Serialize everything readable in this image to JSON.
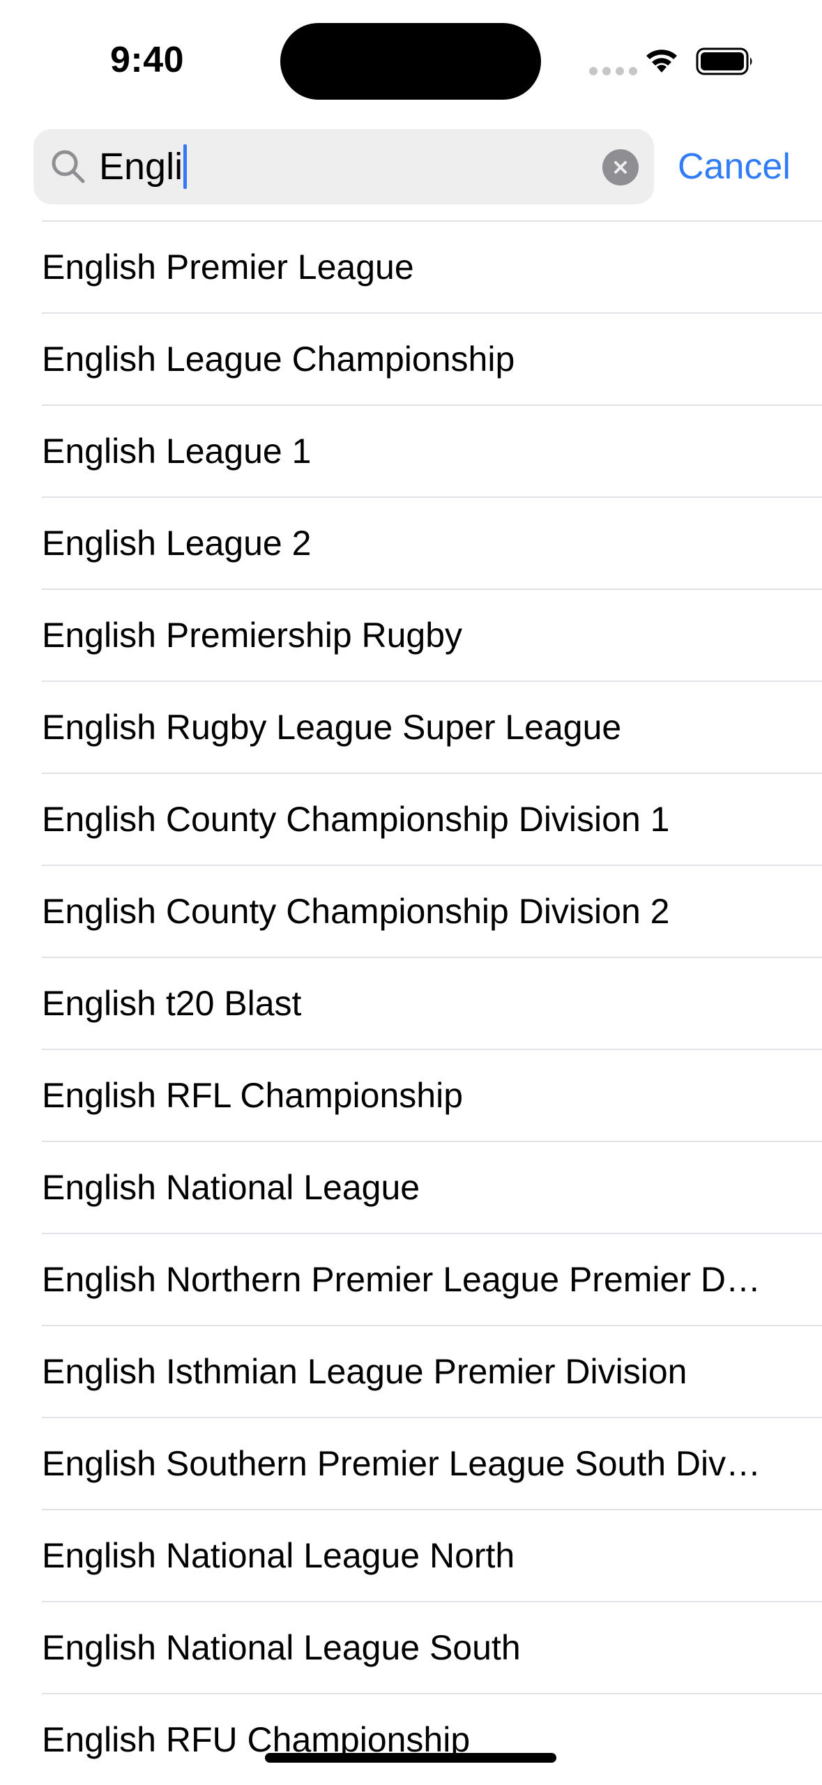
{
  "status_bar": {
    "time": "9:40"
  },
  "search": {
    "value": "Engli",
    "cancel_label": "Cancel",
    "accent_color": "#2f7cf6"
  },
  "results": [
    {
      "label": "English Premier League"
    },
    {
      "label": "English League Championship"
    },
    {
      "label": "English League 1"
    },
    {
      "label": "English League 2"
    },
    {
      "label": "English Premiership Rugby"
    },
    {
      "label": "English Rugby League Super League"
    },
    {
      "label": "English County Championship Division 1"
    },
    {
      "label": "English County Championship Division 2"
    },
    {
      "label": "English t20 Blast"
    },
    {
      "label": "English RFL Championship"
    },
    {
      "label": "English National League"
    },
    {
      "label": "English Northern Premier League Premier Di…"
    },
    {
      "label": "English Isthmian League Premier Division"
    },
    {
      "label": "English Southern Premier League South Divi…"
    },
    {
      "label": "English National League North"
    },
    {
      "label": "English National League South"
    },
    {
      "label": "English RFU Championship"
    }
  ],
  "icons": {
    "wifi": "wifi-icon",
    "battery": "battery-icon",
    "search": "search-icon",
    "clear": "clear-icon"
  }
}
